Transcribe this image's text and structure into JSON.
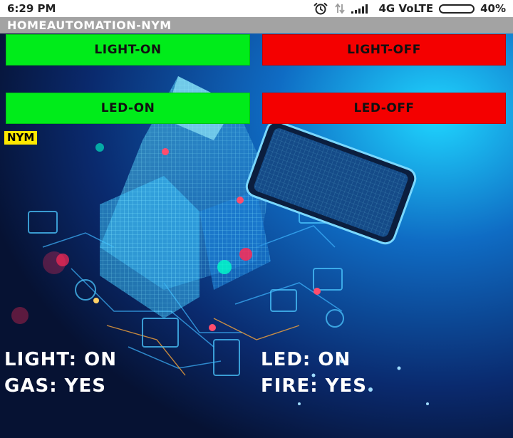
{
  "status_bar": {
    "time": "6:29 PM",
    "network": "4G VoLTE",
    "battery": "40%",
    "battery_level": 0.4,
    "icons": [
      "alarm-icon",
      "data-arrows-icon",
      "signal-icon",
      "battery-icon"
    ]
  },
  "app": {
    "title": "HOMEAUTOMATION-NYM"
  },
  "buttons": {
    "light_on": "LIGHT-ON",
    "light_off": "LIGHT-OFF",
    "led_on": "LED-ON",
    "led_off": "LED-OFF"
  },
  "tag": "NYM",
  "readings": {
    "light": "LIGHT: ON",
    "led": "LED: ON",
    "gas": "GAS: YES",
    "fire": "FIRE: YES"
  },
  "colors": {
    "on_button": "#00ec1a",
    "off_button": "#f40000",
    "tag_background": "#ffe800",
    "title_bar": "#a3a3a3"
  }
}
